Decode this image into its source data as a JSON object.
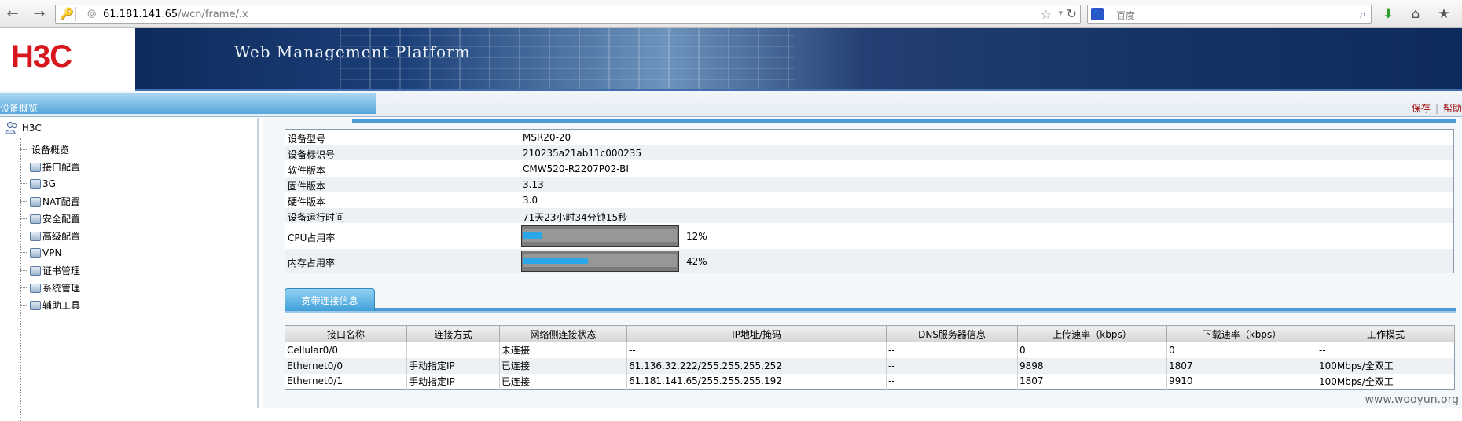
{
  "browser": {
    "url_host": "61.181.141.65",
    "url_path": "/wcn/frame/.x",
    "search_placeholder": "百度"
  },
  "header": {
    "logo": "H3C",
    "title": "Web Management Platform"
  },
  "subbar": {
    "tab_label": "设备概览",
    "save": "保存",
    "help": "帮助"
  },
  "sidebar": {
    "root": "H3C",
    "items": [
      {
        "label": "设备概览",
        "has_icon": false
      },
      {
        "label": "接口配置",
        "has_icon": true
      },
      {
        "label": "3G",
        "has_icon": true
      },
      {
        "label": "NAT配置",
        "has_icon": true
      },
      {
        "label": "安全配置",
        "has_icon": true
      },
      {
        "label": "高级配置",
        "has_icon": true
      },
      {
        "label": "VPN",
        "has_icon": true
      },
      {
        "label": "证书管理",
        "has_icon": true
      },
      {
        "label": "系统管理",
        "has_icon": true
      },
      {
        "label": "辅助工具",
        "has_icon": true
      }
    ]
  },
  "device_info": {
    "rows": [
      {
        "key": "设备型号",
        "value": "MSR20-20"
      },
      {
        "key": "设备标识号",
        "value": "210235a21ab11c000235"
      },
      {
        "key": "软件版本",
        "value": "CMW520-R2207P02-BI"
      },
      {
        "key": "固件版本",
        "value": "3.13"
      },
      {
        "key": "硬件版本",
        "value": "3.0"
      },
      {
        "key": "设备运行时间",
        "value": "71天23小时34分钟15秒"
      }
    ],
    "cpu": {
      "key": "CPU占用率",
      "percent": 12,
      "text": "12%"
    },
    "memory": {
      "key": "内存占用率",
      "percent": 42,
      "text": "42%"
    }
  },
  "broadband": {
    "tab_label": "宽带连接信息",
    "columns": [
      "接口名称",
      "连接方式",
      "网络侧连接状态",
      "IP地址/掩码",
      "DNS服务器信息",
      "上传速率（kbps）",
      "下载速率（kbps）",
      "工作模式"
    ],
    "rows": [
      [
        "Cellular0/0",
        "",
        "未连接",
        "--",
        "--",
        "0",
        "0",
        "--"
      ],
      [
        "Ethernet0/0",
        "手动指定IP",
        "已连接",
        "61.136.32.222/255.255.255.252",
        "--",
        "9898",
        "1807",
        "100Mbps/全双工"
      ],
      [
        "Ethernet0/1",
        "手动指定IP",
        "已连接",
        "61.181.141.65/255.255.255.192",
        "--",
        "1807",
        "9910",
        "100Mbps/全双工"
      ]
    ]
  },
  "watermark": "www.wooyun.org"
}
